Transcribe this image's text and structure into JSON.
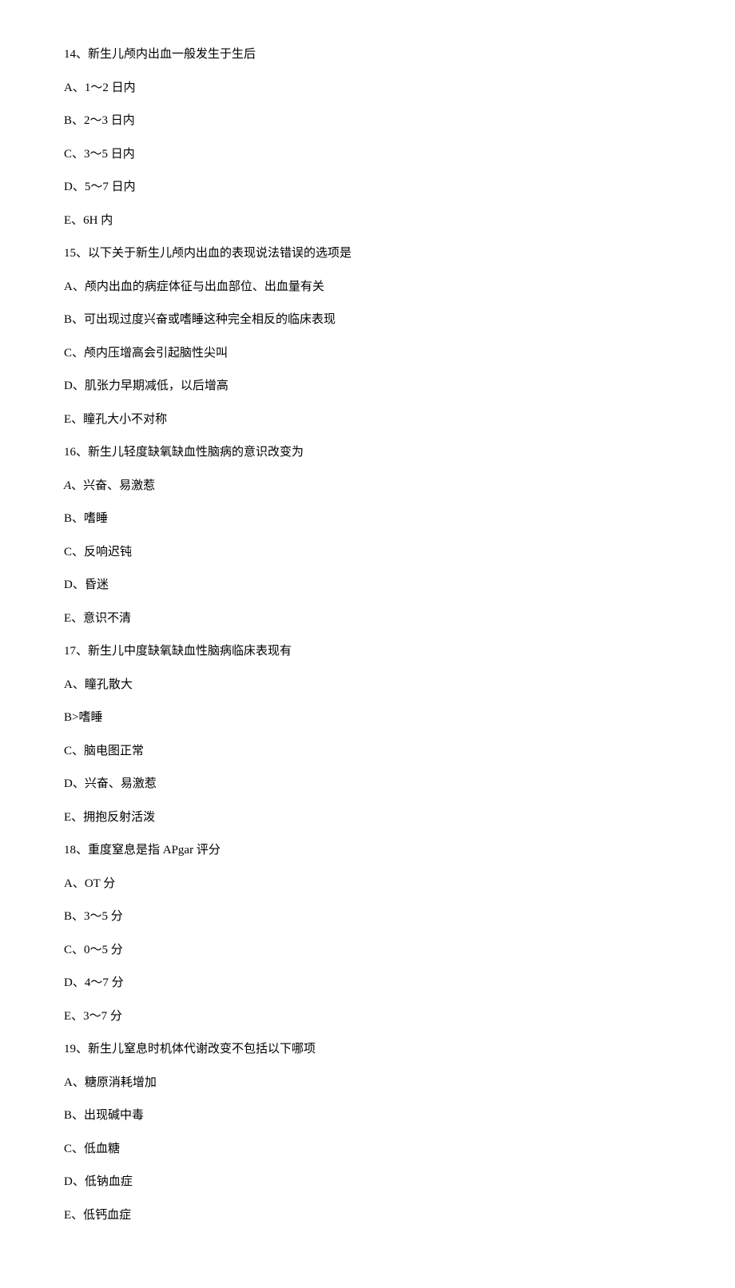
{
  "questions": [
    {
      "stem": "14、新生儿颅内出血一般发生于生后",
      "options": [
        "A、1～2 日内",
        "B、2～3 日内",
        "C、3～5 日内",
        "D、5～7 日内",
        "E、6H 内"
      ]
    },
    {
      "stem": "15、以下关于新生儿颅内出血的表现说法错误的选项是",
      "options": [
        "A、颅内出血的病症体征与出血部位、出血量有关",
        "B、可出现过度兴奋或嗜睡这种完全相反的临床表现",
        "C、颅内压增高会引起脑性尖叫",
        "D、肌张力早期减低，以后增高",
        "E、瞳孔大小不对称"
      ]
    },
    {
      "stem": "16、新生儿轻度缺氧缺血性脑病的意识改变为",
      "options": [
        {
          "prefix": "A",
          "rest": "、兴奋、易激惹",
          "italicPrefix": true
        },
        "B、嗜睡",
        "C、反响迟钝",
        "D、昏迷",
        "E、意识不清"
      ]
    },
    {
      "stem": "17、新生儿中度缺氧缺血性脑病临床表现有",
      "options": [
        "A、瞳孔散大",
        "B>嗜睡",
        "C、脑电图正常",
        "D、兴奋、易激惹",
        "E、拥抱反射活泼"
      ]
    },
    {
      "stem": "18、重度窒息是指 APgar 评分",
      "options": [
        "A、OT 分",
        "B、3～5 分",
        "C、0～5 分",
        "D、4～7 分",
        "E、3～7 分"
      ]
    },
    {
      "stem": "19、新生儿窒息时机体代谢改变不包括以下哪项",
      "options": [
        "A、糖原消耗增加",
        "B、出现碱中毒",
        "C、低血糖",
        "D、低钠血症",
        "E、低钙血症"
      ]
    }
  ]
}
